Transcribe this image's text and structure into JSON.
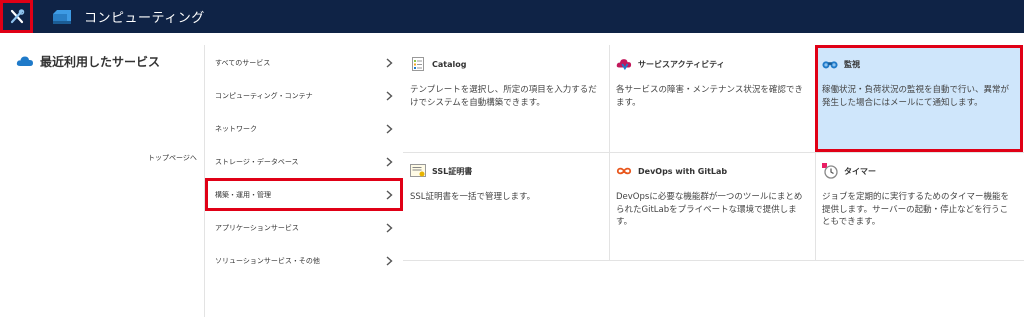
{
  "header": {
    "title": "コンピューティング",
    "menu_icon": "wrench-cross-icon",
    "app_icon": "server-box-icon"
  },
  "left": {
    "recent_label": "最近利用したサービス",
    "toppage_label": "トップページへ"
  },
  "categories": [
    {
      "label": "すべてのサービス",
      "active": false
    },
    {
      "label": "コンピューティング・コンテナ",
      "active": false
    },
    {
      "label": "ネットワーク",
      "active": false
    },
    {
      "label": "ストレージ・データベース",
      "active": false
    },
    {
      "label": "構築・運用・管理",
      "active": true
    },
    {
      "label": "アプリケーションサービス",
      "active": false
    },
    {
      "label": "ソリューションサービス・その他",
      "active": false
    }
  ],
  "services": [
    {
      "title": "Catalog",
      "icon": "catalog-list-icon",
      "desc": "テンプレートを選択し、所定の項目を入力するだけでシステムを自動構築できます。"
    },
    {
      "title": "サービスアクティビティ",
      "icon": "cloud-activity-icon",
      "desc": "各サービスの障害・メンテナンス状況を確認できます。"
    },
    {
      "title": "監視",
      "icon": "binoculars-icon",
      "desc": "稼働状況・負荷状況の監視を自動で行い、異常が発生した場合にはメールにて通知します。",
      "highlight": true
    },
    {
      "title": "SSL証明書",
      "icon": "certificate-icon",
      "desc": "SSL証明書を一括で管理します。"
    },
    {
      "title": "DevOps with GitLab",
      "icon": "infinity-icon",
      "desc": "DevOpsに必要な機能群が一つのツールにまとめられたGitLabをプライベートな環境で提供します。"
    },
    {
      "title": "タイマー",
      "icon": "timer-clock-icon",
      "desc": "ジョブを定期的に実行するためのタイマー機能を提供します。サーバーの起動・停止などを行うこともできます。"
    }
  ],
  "colors": {
    "header_bg": "#0f2346",
    "highlight_bg": "#cfe6fb",
    "annotation_red": "#e00016",
    "accent_blue": "#1f7ac9"
  }
}
